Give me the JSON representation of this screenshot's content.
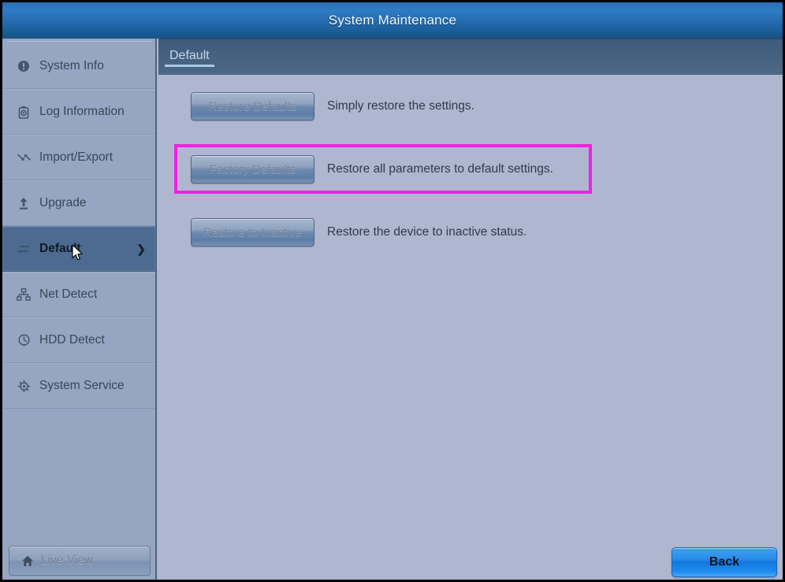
{
  "window": {
    "title": "System Maintenance"
  },
  "sidebar": {
    "items": [
      {
        "label": "System Info",
        "icon": "info-circle-icon",
        "selected": false
      },
      {
        "label": "Log Information",
        "icon": "log-camera-icon",
        "selected": false
      },
      {
        "label": "Import/Export",
        "icon": "import-export-icon",
        "selected": false
      },
      {
        "label": "Upgrade",
        "icon": "upload-arrow-icon",
        "selected": false
      },
      {
        "label": "Default",
        "icon": "restore-loop-icon",
        "selected": true,
        "chevron": "❯"
      },
      {
        "label": "Net Detect",
        "icon": "network-icon",
        "selected": false
      },
      {
        "label": "HDD Detect",
        "icon": "hdd-clock-icon",
        "selected": false
      },
      {
        "label": "System Service",
        "icon": "gear-icon",
        "selected": false
      }
    ],
    "live_view": {
      "label": "Live View",
      "icon": "home-icon"
    }
  },
  "tabs": [
    {
      "label": "Default",
      "active": true
    }
  ],
  "main": {
    "rows": [
      {
        "button_label": "Restore Defaults",
        "description": "Simply restore the settings.",
        "highlighted": false
      },
      {
        "button_label": "Factory Defaults",
        "description": "Restore all parameters to default settings.",
        "highlighted": true
      },
      {
        "button_label": "Restore to Inactive",
        "description": "Restore the device to inactive status.",
        "highlighted": false
      }
    ]
  },
  "footer": {
    "back_label": "Back"
  },
  "colors": {
    "titlebar_blue": "#2a6fb4",
    "sidebar_bg": "#96a6c2",
    "content_bg": "#aeb7cf",
    "tabbar_bg": "#466280",
    "selected_item": "#4d6b90",
    "highlight_magenta": "#f122e0",
    "back_button_blue": "#1178dd"
  }
}
